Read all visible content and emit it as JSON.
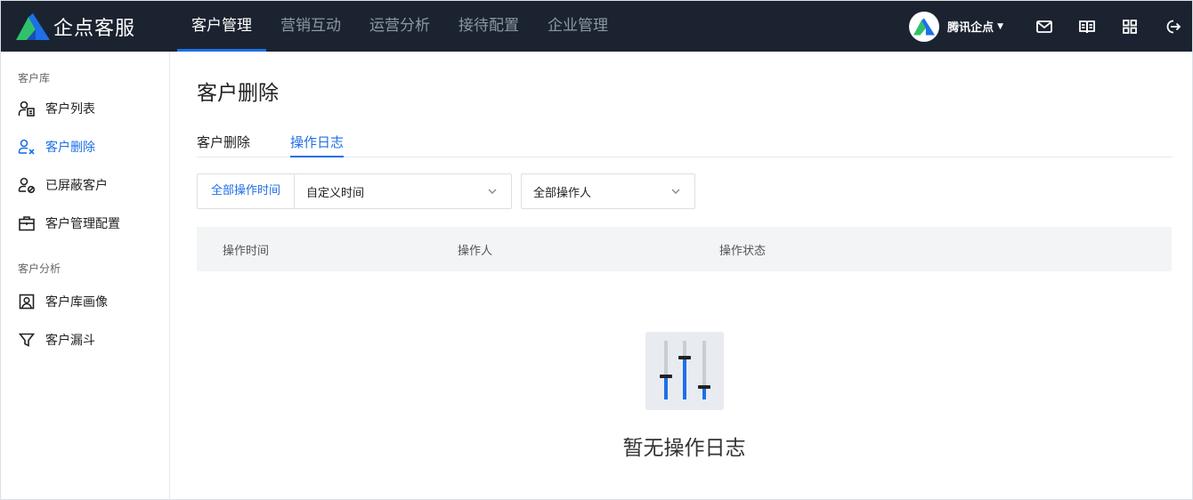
{
  "app": {
    "name": "企点客服"
  },
  "nav": {
    "items": [
      {
        "label": "客户管理",
        "active": true
      },
      {
        "label": "营销互动",
        "active": false
      },
      {
        "label": "运营分析",
        "active": false
      },
      {
        "label": "接待配置",
        "active": false
      },
      {
        "label": "企业管理",
        "active": false
      }
    ]
  },
  "user": {
    "name": "腾讯企点"
  },
  "toolbar": {
    "icons": [
      "mail-icon",
      "book-icon",
      "apps-grid-icon",
      "logout-icon"
    ]
  },
  "sidebar": {
    "groups": [
      {
        "title": "客户库",
        "items": [
          {
            "label": "客户列表",
            "icon": "customer-list-icon",
            "active": false
          },
          {
            "label": "客户删除",
            "icon": "customer-delete-icon",
            "active": true
          },
          {
            "label": "已屏蔽客户",
            "icon": "blocked-customer-icon",
            "active": false
          },
          {
            "label": "客户管理配置",
            "icon": "briefcase-icon",
            "active": false
          }
        ]
      },
      {
        "title": "客户分析",
        "items": [
          {
            "label": "客户库画像",
            "icon": "portrait-icon",
            "active": false
          },
          {
            "label": "客户漏斗",
            "icon": "funnel-icon",
            "active": false
          }
        ]
      }
    ]
  },
  "main": {
    "title": "客户删除",
    "tabs": [
      {
        "label": "客户删除",
        "active": false
      },
      {
        "label": "操作日志",
        "active": true
      }
    ],
    "filters": {
      "time_all": "全部操作时间",
      "time_custom": "自定义时间",
      "operator": "全部操作人"
    },
    "table": {
      "columns": [
        "操作时间",
        "操作人",
        "操作状态"
      ]
    },
    "empty": {
      "text": "暂无操作日志"
    }
  },
  "colors": {
    "topbar": "#1b2330",
    "accent": "#1e6fe8",
    "logo_green": "#2fc26b"
  }
}
